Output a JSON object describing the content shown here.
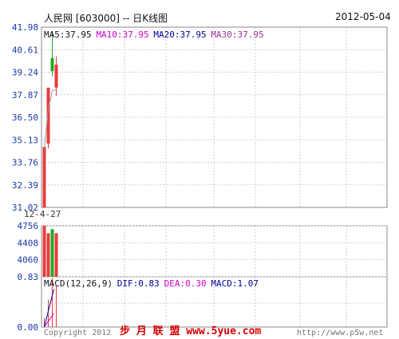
{
  "header": {
    "title": "人民网  [603000] -- 日K线图",
    "date": "2012-05-04"
  },
  "chart_data": [
    {
      "type": "candlestick",
      "name": "price",
      "y_ticks": [
        "41.98",
        "40.61",
        "39.24",
        "37.87",
        "36.50",
        "35.13",
        "33.76",
        "32.39",
        "31.02"
      ],
      "ylim": [
        31.02,
        41.98
      ],
      "x_tick_label": "12-4-27",
      "candles": [
        {
          "open": 34.7,
          "high": 34.7,
          "low": 31.0,
          "close": 31.0,
          "color": "#e83b3b"
        },
        {
          "open": 38.3,
          "high": 38.3,
          "low": 34.6,
          "close": 34.9,
          "color": "#e83b3b"
        },
        {
          "open": 39.3,
          "high": 41.7,
          "low": 39.0,
          "close": 40.1,
          "color": "#22aa22"
        },
        {
          "open": 39.7,
          "high": 40.2,
          "low": 37.8,
          "close": 38.3,
          "color": "#e83b3b"
        }
      ],
      "ma_line_points": [
        [
          0,
          34.6
        ],
        [
          1,
          37.0
        ],
        [
          2,
          38.1
        ],
        [
          3,
          38.2
        ]
      ],
      "legend": [
        {
          "label": "MA5:37.95",
          "color": "#111111"
        },
        {
          "label": "MA10:37.95",
          "color": "#cc00cc"
        },
        {
          "label": "MA20:37.95",
          "color": "#000099"
        },
        {
          "label": "MA30:37.95",
          "color": "#993399"
        }
      ]
    },
    {
      "type": "bar",
      "name": "volume",
      "y_ticks": [
        "4756",
        "4408",
        "4060",
        "0.83"
      ],
      "ylim": [
        0.83,
        4756
      ],
      "values": [
        {
          "value": 4756,
          "color": "#e83b3b"
        },
        {
          "value": 4060,
          "color": "#e83b3b"
        },
        {
          "value": 4440,
          "color": "#22aa22"
        },
        {
          "value": 4060,
          "color": "#e83b3b"
        }
      ]
    },
    {
      "type": "line",
      "name": "macd",
      "y_ticks": [
        "0.00"
      ],
      "legend": [
        {
          "label": "MACD(12,26,9)",
          "color": "#111111"
        },
        {
          "label": "DIF:0.83",
          "color": "#000099"
        },
        {
          "label": "DEA:0.30",
          "color": "#cc00cc"
        },
        {
          "label": "MACD:1.07",
          "color": "#000099"
        }
      ],
      "dif": [
        0.0,
        0.42,
        0.83
      ],
      "dea": [
        0.0,
        0.15,
        0.3
      ],
      "macd_bars": [
        0.2,
        0.6,
        1.07,
        0.9
      ],
      "ylim": [
        0.0,
        1.1
      ]
    }
  ],
  "footer": {
    "copyright": "Copyright 2012",
    "watermark": "步 月 联 盟  www.5yue.com",
    "url": "http://www.p5w.net"
  },
  "colors": {
    "up": "#e83b3b",
    "down": "#22aa22",
    "axis_text": "#1a3aa8",
    "grid": "#cfcfcf"
  }
}
